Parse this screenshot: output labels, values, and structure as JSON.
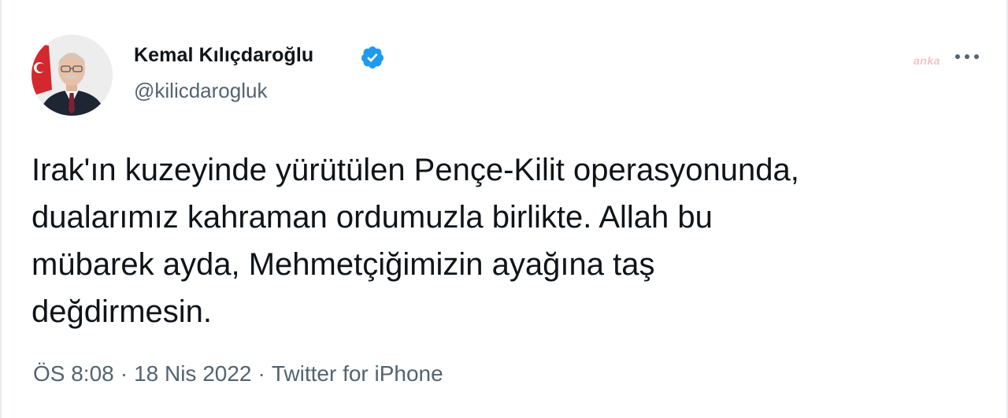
{
  "tweet": {
    "author": {
      "name": "Kemal Kılıçdaroğlu",
      "handle": "@kilicdarogluk",
      "verified": true
    },
    "watermark": "anka",
    "text_lines": [
      "Irak'ın kuzeyinde yürütülen Pençe-Kilit operasyonunda,",
      "dualarımız kahraman ordumuzla birlikte. Allah bu",
      "mübarek ayda, Mehmetçiğimizin ayağına taş",
      "değdirmesin."
    ],
    "meta": {
      "time": "ÖS 8:08",
      "separator": "·",
      "date": "18 Nis 2022",
      "source": "Twitter for iPhone"
    },
    "icons": {
      "verified": "verified-badge-icon",
      "more": "more-options-icon"
    },
    "colors": {
      "verified": "#1d9bf0",
      "secondary_text": "#536471",
      "primary_text": "#0f1419",
      "watermark": "#f1c3c3"
    }
  }
}
